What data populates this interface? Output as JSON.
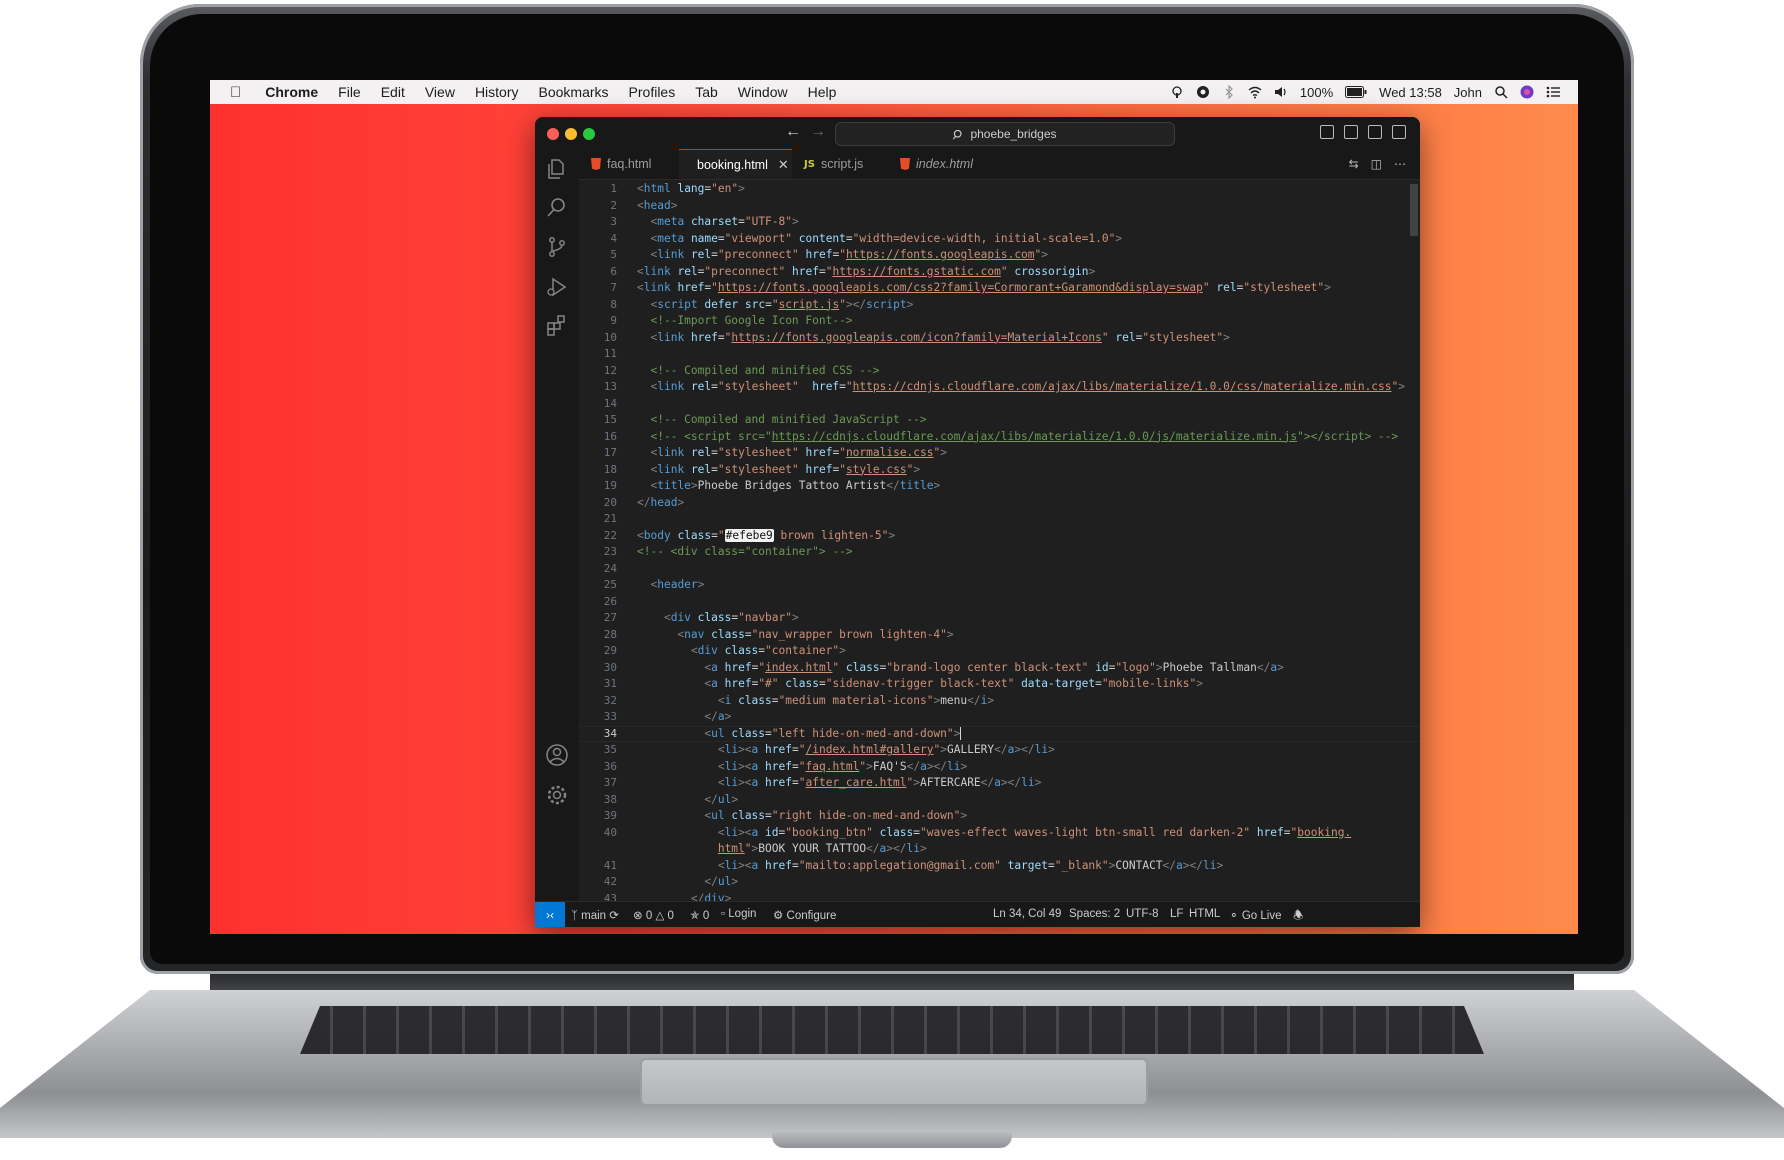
{
  "menubar": {
    "apple_icon": "apple-logo",
    "app": "Chrome",
    "items": [
      "File",
      "Edit",
      "View",
      "History",
      "Bookmarks",
      "Profiles",
      "Tab",
      "Window",
      "Help"
    ],
    "battery": "100%",
    "datetime": "Wed 13:58",
    "user": "John"
  },
  "window": {
    "search_text": "phoebe_bridges"
  },
  "tabs": [
    {
      "label": "faq.html",
      "icon": "html-file-icon"
    },
    {
      "label": "booking.html",
      "icon": "html-file-icon",
      "active": true
    },
    {
      "label": "script.js",
      "icon": "js-file-icon"
    },
    {
      "label": "index.html",
      "icon": "html-file-icon"
    }
  ],
  "js_badge": "JS",
  "editor": {
    "current_line": 34,
    "lines": [
      {
        "n": "1",
        "html": "<span class='p'>&lt;</span><span class='t'>html</span> <span class='at'>lang</span>=<span class='s'>\"en\"</span><span class='p'>&gt;</span>"
      },
      {
        "n": "2",
        "html": "<span class='p'>&lt;</span><span class='t'>head</span><span class='p'>&gt;</span>"
      },
      {
        "n": "3",
        "html": "  <span class='p'>&lt;</span><span class='t'>meta</span> <span class='at'>charset</span>=<span class='s'>\"UTF-8\"</span><span class='p'>&gt;</span>"
      },
      {
        "n": "4",
        "html": "  <span class='p'>&lt;</span><span class='t'>meta</span> <span class='at'>name</span>=<span class='s'>\"viewport\"</span> <span class='at'>content</span>=<span class='s'>\"width=device-width, initial-scale=1.0\"</span><span class='p'>&gt;</span>"
      },
      {
        "n": "5",
        "html": "  <span class='p'>&lt;</span><span class='t'>link</span> <span class='at'>rel</span>=<span class='s'>\"preconnect\"</span> <span class='at'>href</span>=<span class='s'>\"<span class='u'>https://fonts.googleapis.com</span>\"</span><span class='p'>&gt;</span>"
      },
      {
        "n": "6",
        "html": "<span class='p'>&lt;</span><span class='t'>link</span> <span class='at'>rel</span>=<span class='s'>\"preconnect\"</span> <span class='at'>href</span>=<span class='s'>\"<span class='u'>https://fonts.gstatic.com</span>\"</span> <span class='at'>crossorigin</span><span class='p'>&gt;</span>"
      },
      {
        "n": "7",
        "html": "<span class='p'>&lt;</span><span class='t'>link</span> <span class='at'>href</span>=<span class='s'>\"<span class='u'>https://fonts.googleapis.com/css2?family=Cormorant+Garamond&amp;display=swap</span>\"</span> <span class='at'>rel</span>=<span class='s'>\"stylesheet\"</span><span class='p'>&gt;</span>"
      },
      {
        "n": "8",
        "html": "  <span class='p'>&lt;</span><span class='t'>script</span> <span class='at'>defer</span> <span class='at'>src</span>=<span class='s'>\"<span class='u'>script.js</span>\"</span><span class='p'>&gt;&lt;/</span><span class='t'>script</span><span class='p'>&gt;</span>"
      },
      {
        "n": "9",
        "html": "  <span class='c'>&lt;!--Import Google Icon Font--&gt;</span>"
      },
      {
        "n": "10",
        "html": "  <span class='p'>&lt;</span><span class='t'>link</span> <span class='at'>href</span>=<span class='s'>\"<span class='u'>https://fonts.googleapis.com/icon?family=Material+Icons</span>\"</span> <span class='at'>rel</span>=<span class='s'>\"stylesheet\"</span><span class='p'>&gt;</span>"
      },
      {
        "n": "11",
        "html": ""
      },
      {
        "n": "12",
        "html": "  <span class='c'>&lt;!-- Compiled and minified CSS --&gt;</span>"
      },
      {
        "n": "13",
        "html": "  <span class='p'>&lt;</span><span class='t'>link</span> <span class='at'>rel</span>=<span class='s'>\"stylesheet\"</span>  <span class='at'>href</span>=<span class='s'>\"<span class='u'>https://cdnjs.cloudflare.com/ajax/libs/materialize/1.0.0/css/materialize.min.css</span>\"</span><span class='p'>&gt;</span>"
      },
      {
        "n": "14",
        "html": ""
      },
      {
        "n": "15",
        "html": "  <span class='c'>&lt;!-- Compiled and minified JavaScript --&gt;</span>"
      },
      {
        "n": "16",
        "html": "  <span class='c'>&lt;!-- &lt;script src=\"<span class='u'>https://cdnjs.cloudflare.com/ajax/libs/materialize/1.0.0/js/materialize.min.js</span>\"&gt;&lt;/script&gt; --&gt;</span>"
      },
      {
        "n": "17",
        "html": "  <span class='p'>&lt;</span><span class='t'>link</span> <span class='at'>rel</span>=<span class='s'>\"stylesheet\"</span> <span class='at'>href</span>=<span class='s'>\"<span class='u'>normalise.css</span>\"</span><span class='p'>&gt;</span>"
      },
      {
        "n": "18",
        "html": "  <span class='p'>&lt;</span><span class='t'>link</span> <span class='at'>rel</span>=<span class='s'>\"stylesheet\"</span> <span class='at'>href</span>=<span class='s'>\"<span class='u'>style.css</span>\"</span><span class='p'>&gt;</span>"
      },
      {
        "n": "19",
        "html": "  <span class='p'>&lt;</span><span class='t'>title</span><span class='p'>&gt;</span>Phoebe Bridges Tattoo Artist<span class='p'>&lt;/</span><span class='t'>title</span><span class='p'>&gt;</span>"
      },
      {
        "n": "20",
        "html": "<span class='p'>&lt;/</span><span class='t'>head</span><span class='p'>&gt;</span>"
      },
      {
        "n": "21",
        "html": ""
      },
      {
        "n": "22",
        "html": "<span class='p'>&lt;</span><span class='t'>body</span> <span class='at'>class</span>=<span class='s'>\"<span class='hl'>#efebe9</span> brown lighten-5\"</span><span class='p'>&gt;</span>"
      },
      {
        "n": "23",
        "html": "<span class='c'>&lt;!-- &lt;div class=\"container\"&gt; --&gt;</span>"
      },
      {
        "n": "24",
        "html": ""
      },
      {
        "n": "25",
        "html": "  <span class='p'>&lt;</span><span class='t'>header</span><span class='p'>&gt;</span>"
      },
      {
        "n": "26",
        "html": ""
      },
      {
        "n": "27",
        "html": "    <span class='p'>&lt;</span><span class='t'>div</span> <span class='at'>class</span>=<span class='s'>\"navbar\"</span><span class='p'>&gt;</span>"
      },
      {
        "n": "28",
        "html": "      <span class='p'>&lt;</span><span class='t'>nav</span> <span class='at'>class</span>=<span class='s'>\"nav_wrapper brown lighten-4\"</span><span class='p'>&gt;</span>"
      },
      {
        "n": "29",
        "html": "        <span class='p'>&lt;</span><span class='t'>div</span> <span class='at'>class</span>=<span class='s'>\"container\"</span><span class='p'>&gt;</span>"
      },
      {
        "n": "30",
        "html": "          <span class='p'>&lt;</span><span class='t'>a</span> <span class='at'>href</span>=<span class='s'>\"<span class='u'>index.html</span>\"</span> <span class='at'>class</span>=<span class='s'>\"brand-logo center black-text\"</span> <span class='at'>id</span>=<span class='s'>\"logo\"</span><span class='p'>&gt;</span>Phoebe Tallman<span class='p'>&lt;/</span><span class='t'>a</span><span class='p'>&gt;</span>"
      },
      {
        "n": "31",
        "html": "          <span class='p'>&lt;</span><span class='t'>a</span> <span class='at'>href</span>=<span class='s'>\"#\"</span> <span class='at'>class</span>=<span class='s'>\"sidenav-trigger black-text\"</span> <span class='at'>data-target</span>=<span class='s'>\"mobile-links\"</span><span class='p'>&gt;</span>"
      },
      {
        "n": "32",
        "html": "            <span class='p'>&lt;</span><span class='t'>i</span> <span class='at'>class</span>=<span class='s'>\"medium material-icons\"</span><span class='p'>&gt;</span>menu<span class='p'>&lt;/</span><span class='t'>i</span><span class='p'>&gt;</span>"
      },
      {
        "n": "33",
        "html": "          <span class='p'>&lt;/</span><span class='t'>a</span><span class='p'>&gt;</span>"
      },
      {
        "n": "34",
        "html": "          <span class='p'>&lt;</span><span class='t'>ul</span> <span class='at'>class</span>=<span class='s'>\"left hide-on-med-and-down\"</span><span class='p'>&gt;</span><span class='caret'></span>"
      },
      {
        "n": "35",
        "html": "            <span class='p'>&lt;</span><span class='t'>li</span><span class='p'>&gt;&lt;</span><span class='t'>a</span> <span class='at'>href</span>=<span class='s'>\"<span class='u'>/index.html#gallery</span>\"</span><span class='p'>&gt;</span>GALLERY<span class='p'>&lt;/</span><span class='t'>a</span><span class='p'>&gt;&lt;/</span><span class='t'>li</span><span class='p'>&gt;</span>"
      },
      {
        "n": "36",
        "html": "            <span class='p'>&lt;</span><span class='t'>li</span><span class='p'>&gt;&lt;</span><span class='t'>a</span> <span class='at'>href</span>=<span class='s'>\"<span class='u'>faq.html</span>\"</span><span class='p'>&gt;</span>FAQ'S<span class='p'>&lt;/</span><span class='t'>a</span><span class='p'>&gt;&lt;/</span><span class='t'>li</span><span class='p'>&gt;</span>"
      },
      {
        "n": "37",
        "html": "            <span class='p'>&lt;</span><span class='t'>li</span><span class='p'>&gt;&lt;</span><span class='t'>a</span> <span class='at'>href</span>=<span class='s'>\"<span class='u'>after_care.html</span>\"</span><span class='p'>&gt;</span>AFTERCARE<span class='p'>&lt;/</span><span class='t'>a</span><span class='p'>&gt;&lt;/</span><span class='t'>li</span><span class='p'>&gt;</span>"
      },
      {
        "n": "38",
        "html": "          <span class='p'>&lt;/</span><span class='t'>ul</span><span class='p'>&gt;</span>"
      },
      {
        "n": "39",
        "html": "          <span class='p'>&lt;</span><span class='t'>ul</span> <span class='at'>class</span>=<span class='s'>\"right hide-on-med-and-down\"</span><span class='p'>&gt;</span>"
      },
      {
        "n": "40",
        "html": "            <span class='p'>&lt;</span><span class='t'>li</span><span class='p'>&gt;&lt;</span><span class='t'>a</span> <span class='at'>id</span>=<span class='s'>\"booking_btn\"</span> <span class='at'>class</span>=<span class='s'>\"waves-effect waves-light btn-small red darken-2\"</span> <span class='at'>href</span>=<span class='s'>\"<span class='u'>booking.</span></span>"
      },
      {
        "n": "",
        "html": "            <span class='s'><span class='u'>html</span>\"</span><span class='p'>&gt;</span>BOOK YOUR TATTOO<span class='p'>&lt;/</span><span class='t'>a</span><span class='p'>&gt;&lt;/</span><span class='t'>li</span><span class='p'>&gt;</span>"
      },
      {
        "n": "41",
        "html": "            <span class='p'>&lt;</span><span class='t'>li</span><span class='p'>&gt;&lt;</span><span class='t'>a</span> <span class='at'>href</span>=<span class='s'>\"mailto:applegation@gmail.com\"</span> <span class='at'>target</span>=<span class='s'>\"_blank\"</span><span class='p'>&gt;</span>CONTACT<span class='p'>&lt;/</span><span class='t'>a</span><span class='p'>&gt;&lt;/</span><span class='t'>li</span><span class='p'>&gt;</span>"
      },
      {
        "n": "42",
        "html": "          <span class='p'>&lt;/</span><span class='t'>ul</span><span class='p'>&gt;</span>"
      },
      {
        "n": "43",
        "html": "        <span class='p'>&lt;/</span><span class='t'>div</span><span class='p'>&gt;</span>"
      }
    ]
  },
  "statusbar": {
    "branch": "main",
    "errors": "0",
    "warnings": "0",
    "ports": "0",
    "login": "Login",
    "configure": "Configure",
    "position": "Ln 34, Col 49",
    "spaces": "Spaces: 2",
    "encoding": "UTF-8",
    "eol": "LF",
    "language": "HTML",
    "golive": "Go Live"
  },
  "colors": {
    "accent": "#0078d4",
    "wallpaper_left": "#ff3030",
    "wallpaper_right": "#ff8a4c"
  }
}
